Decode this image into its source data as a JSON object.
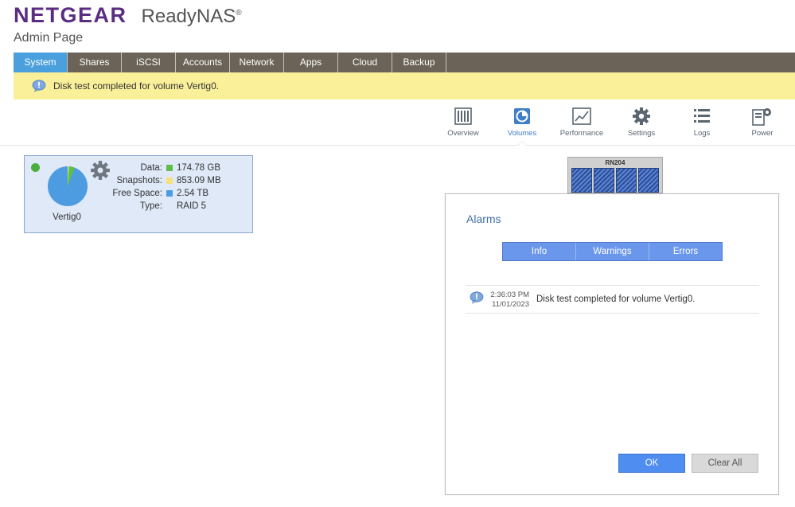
{
  "header": {
    "brand": "NETGEAR",
    "product": "ReadyNAS",
    "registered": "®",
    "subtitle": "Admin Page"
  },
  "nav": {
    "tabs": [
      "System",
      "Shares",
      "iSCSI",
      "Accounts",
      "Network",
      "Apps",
      "Cloud",
      "Backup"
    ],
    "active": "System"
  },
  "notice": {
    "message": "Disk test completed for volume Vertig0.",
    "background": "#faf09a"
  },
  "toolbar": {
    "items": [
      {
        "label": "Overview",
        "icon": "overview-icon"
      },
      {
        "label": "Volumes",
        "icon": "volumes-icon"
      },
      {
        "label": "Performance",
        "icon": "performance-icon"
      },
      {
        "label": "Settings",
        "icon": "settings-gear-icon"
      },
      {
        "label": "Logs",
        "icon": "logs-icon"
      },
      {
        "label": "Power",
        "icon": "power-icon"
      }
    ],
    "active": "Volumes"
  },
  "volume": {
    "name": "Vertig0",
    "status_color": "#4caf3d",
    "stats": [
      {
        "key": "Data:",
        "value": "174.78 GB",
        "color": "#5cbf4a"
      },
      {
        "key": "Snapshots:",
        "value": "853.09 MB",
        "color": "#f4e37a"
      },
      {
        "key": "Free Space:",
        "value": "2.54 TB",
        "color": "#4d9be0"
      },
      {
        "key": "Type:",
        "value": "RAID 5",
        "color": ""
      }
    ]
  },
  "device": {
    "model": "RN204",
    "bays": 4
  },
  "alarms": {
    "title": "Alarms",
    "filters": [
      "Info",
      "Warnings",
      "Errors"
    ],
    "entries": [
      {
        "time": "2:36:03 PM",
        "date": "11/01/2023",
        "message": "Disk test completed for volume Vertig0."
      }
    ],
    "ok_label": "OK",
    "clear_label": "Clear All"
  },
  "colors": {
    "brand_purple": "#5a2d82",
    "nav_bg": "#6b6357",
    "nav_active": "#4aa0dc",
    "accent_blue": "#4f8ef0"
  }
}
